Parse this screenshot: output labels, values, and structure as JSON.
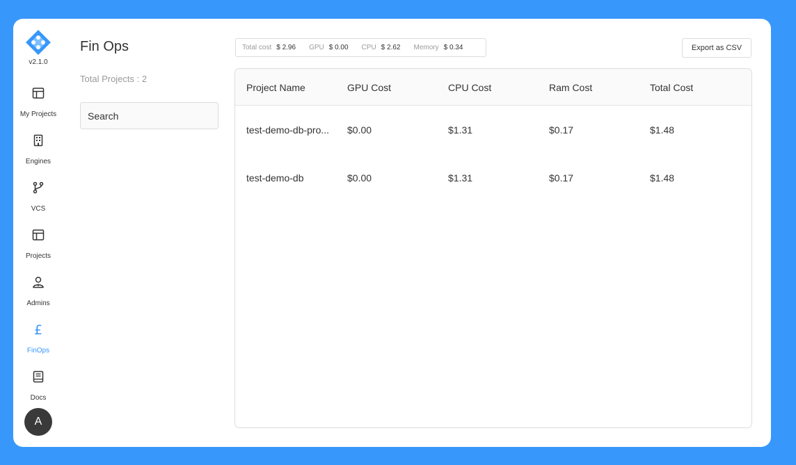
{
  "app": {
    "version": "v2.1.0"
  },
  "sidebar": {
    "items": [
      {
        "label": "My Projects",
        "icon": "layout-icon"
      },
      {
        "label": "Engines",
        "icon": "building-icon"
      },
      {
        "label": "VCS",
        "icon": "git-branch-icon"
      },
      {
        "label": "Projects",
        "icon": "layout-icon"
      },
      {
        "label": "Admins",
        "icon": "admin-user-icon"
      },
      {
        "label": "FinOps",
        "icon": "pound-icon",
        "active": true
      },
      {
        "label": "Docs",
        "icon": "book-icon"
      }
    ],
    "avatar": "A"
  },
  "page": {
    "title": "Fin Ops",
    "total_projects": "Total Projects : 2",
    "search_placeholder": "Search"
  },
  "summary": {
    "total_cost_label": "Total cost",
    "total_cost_value": "$ 2.96",
    "gpu_label": "GPU",
    "gpu_value": "$ 0.00",
    "cpu_label": "CPU",
    "cpu_value": "$ 2.62",
    "memory_label": "Memory",
    "memory_value": "$ 0.34"
  },
  "toolbar": {
    "export_label": "Export as CSV"
  },
  "table": {
    "columns": [
      "Project Name",
      "GPU Cost",
      "CPU Cost",
      "Ram Cost",
      "Total Cost"
    ],
    "rows": [
      [
        "test-demo-db-pro...",
        "$0.00",
        "$1.31",
        "$0.17",
        "$1.48"
      ],
      [
        "test-demo-db",
        "$0.00",
        "$1.31",
        "$0.17",
        "$1.48"
      ]
    ]
  },
  "colors": {
    "accent": "#3897fb",
    "avatar_bg": "#3a3a3a"
  }
}
